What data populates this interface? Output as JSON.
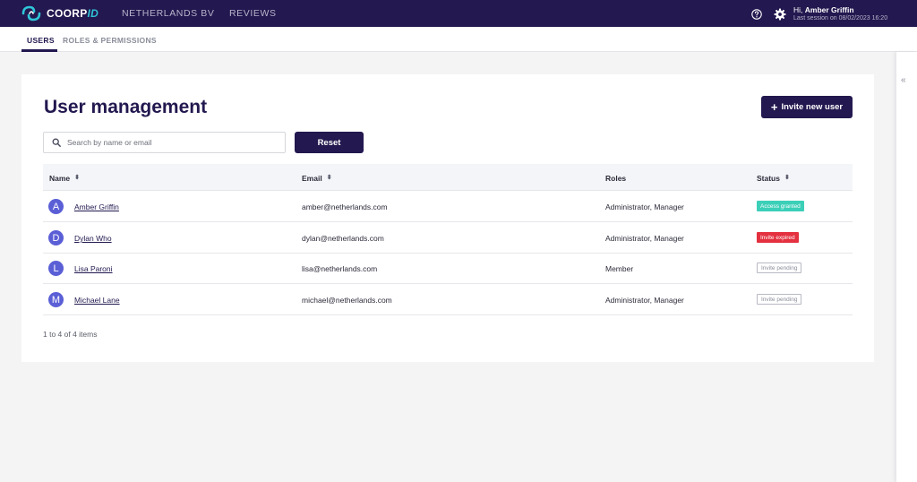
{
  "header": {
    "logo_text_main": "COORP",
    "logo_text_accent": "ID",
    "nav": [
      "NETHERLANDS BV",
      "REVIEWS"
    ],
    "greeting_prefix": "Hi, ",
    "user_name": "Amber Griffin",
    "last_session": "Last session on  08/02/2023 16:20",
    "icons": [
      "help-icon",
      "gear-icon"
    ]
  },
  "tabs": [
    {
      "label": "USERS",
      "active": true
    },
    {
      "label": "ROLES & PERMISSIONS",
      "active": false
    }
  ],
  "rail": {
    "collapse_glyph": "«"
  },
  "main": {
    "title": "User management",
    "invite_label": "Invite new user",
    "search_placeholder": "Search by name or email",
    "reset_label": "Reset",
    "columns": [
      "Name",
      "Email",
      "Roles",
      "Status"
    ],
    "rows": [
      {
        "initial": "A",
        "name": "Amber Griffin",
        "email": "amber@netherlands.com",
        "roles": "Administrator, Manager",
        "status": "Access granted",
        "status_type": "granted"
      },
      {
        "initial": "D",
        "name": "Dylan Who",
        "email": "dylan@netherlands.com",
        "roles": "Administrator, Manager",
        "status": "Invite expired",
        "status_type": "expired"
      },
      {
        "initial": "L",
        "name": "Lisa Paroni",
        "email": "lisa@netherlands.com",
        "roles": "Member",
        "status": "Invite pending",
        "status_type": "pending"
      },
      {
        "initial": "M",
        "name": "Michael Lane",
        "email": "michael@netherlands.com",
        "roles": "Administrator, Manager",
        "status": "Invite pending",
        "status_type": "pending"
      }
    ],
    "pagination": "1 to 4 of 4 items"
  },
  "colors": {
    "brand": "#23184f",
    "accent": "#2fc5d8",
    "avatar": "#5b5fd6",
    "granted": "#3ccfb8",
    "expired": "#e4303f"
  }
}
